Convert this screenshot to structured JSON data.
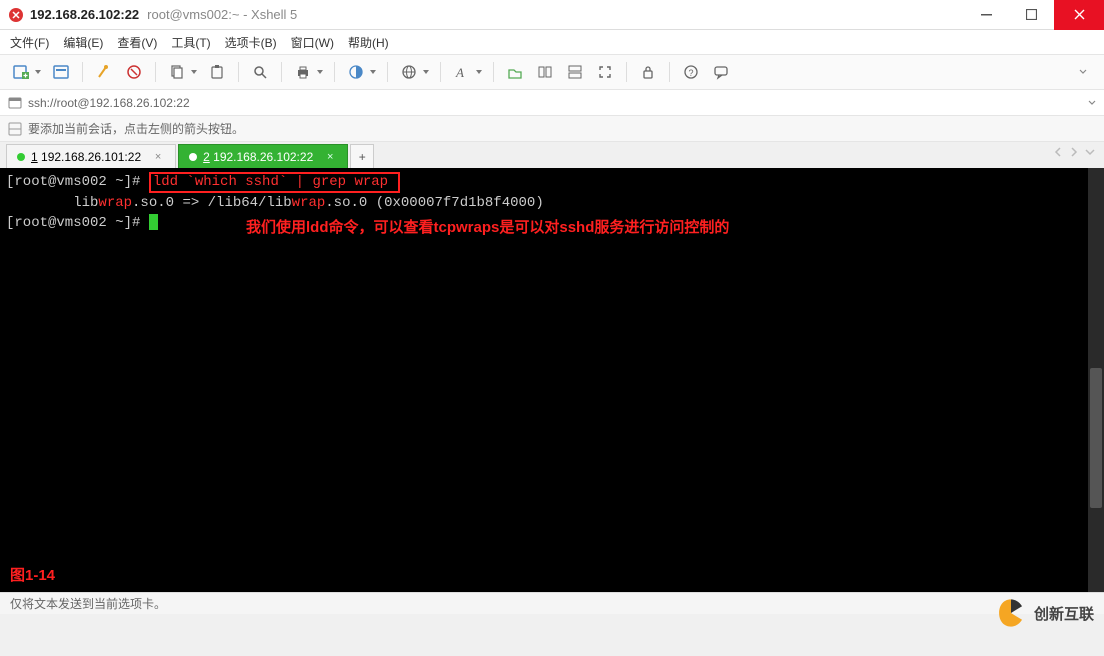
{
  "window": {
    "title_main": "192.168.26.102:22",
    "title_sub": "root@vms002:~ - Xshell 5"
  },
  "menu": {
    "file": "文件(F)",
    "edit": "编辑(E)",
    "view": "查看(V)",
    "tools": "工具(T)",
    "tabs": "选项卡(B)",
    "window": "窗口(W)",
    "help": "帮助(H)"
  },
  "address": {
    "url": "ssh://root@192.168.26.102:22"
  },
  "info": {
    "text": "要添加当前会话，点击左侧的箭头按钮。"
  },
  "tabs": {
    "tab1_num": "1",
    "tab1_label": " 192.168.26.101:22",
    "tab2_num": "2",
    "tab2_label": " 192.168.26.102:22",
    "add": "+"
  },
  "terminal": {
    "prompt1_a": "[root@vms002 ~]# ",
    "cmd1": "ldd `which sshd` | grep wrap ",
    "out_pre": "        lib",
    "out_w1": "wrap",
    "out_mid": ".so.0 => /lib64/lib",
    "out_w2": "wrap",
    "out_post": ".so.0 (0x00007f7d1b8f4000)",
    "prompt2": "[root@vms002 ~]# ",
    "annotation": "我们使用ldd命令，可以查看tcpwraps是可以对sshd服务进行访问控制的",
    "figlabel": "图1-14"
  },
  "status": {
    "text": "仅将文本发送到当前选项卡。"
  },
  "watermark": {
    "text": "创新互联"
  },
  "colors": {
    "tab_active_bg": "#34b233",
    "highlight_red": "#ff2020",
    "close_btn": "#e81123"
  }
}
